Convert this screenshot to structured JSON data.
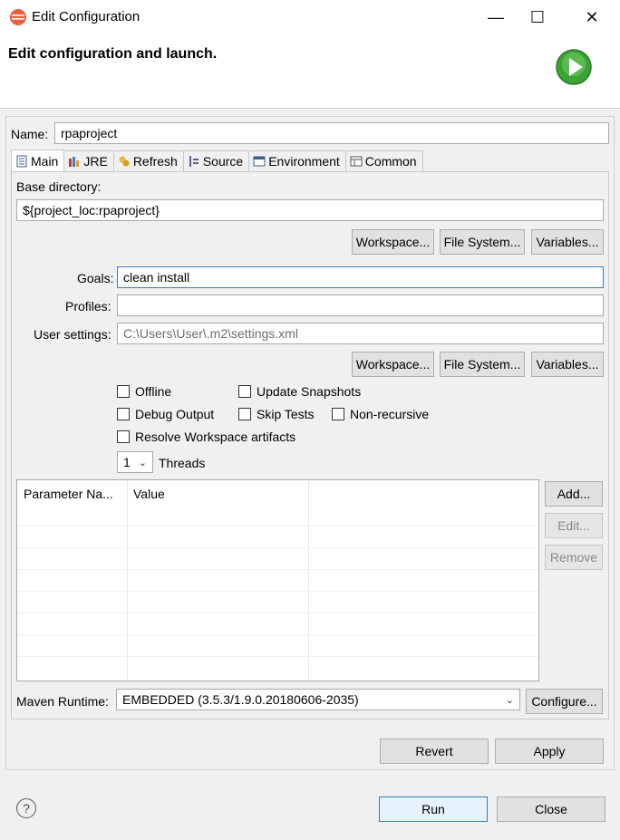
{
  "window": {
    "title": "Edit Configuration",
    "minimize_glyph": "—",
    "maximize_glyph": "☐",
    "close_glyph": "✕"
  },
  "header": {
    "title": "Edit configuration and launch."
  },
  "name": {
    "label": "Name:",
    "value": "rpaproject"
  },
  "tabs": [
    {
      "label": "Main",
      "icon": "main-tab-icon",
      "active": true
    },
    {
      "label": "JRE",
      "icon": "jre-icon"
    },
    {
      "label": "Refresh",
      "icon": "refresh-icon"
    },
    {
      "label": "Source",
      "icon": "source-icon"
    },
    {
      "label": "Environment",
      "icon": "environment-icon"
    },
    {
      "label": "Common",
      "icon": "common-icon"
    }
  ],
  "main": {
    "base_dir_label": "Base directory:",
    "base_dir_value": "${project_loc:rpaproject}",
    "workspace_btn": "Workspace...",
    "filesystem_btn": "File System...",
    "variables_btn": "Variables...",
    "goals_label": "Goals:",
    "goals_value": "clean install",
    "profiles_label": "Profiles:",
    "profiles_value": "",
    "user_settings_label": "User settings:",
    "user_settings_value": "C:\\Users\\User\\.m2\\settings.xml",
    "checkboxes": {
      "offline": "Offline",
      "update_snapshots": "Update Snapshots",
      "debug_output": "Debug Output",
      "skip_tests": "Skip Tests",
      "non_recursive": "Non-recursive",
      "resolve_workspace": "Resolve Workspace artifacts"
    },
    "threads_value": "1",
    "threads_label": "Threads",
    "table": {
      "columns": [
        "Parameter Na...",
        "Value"
      ],
      "rows": []
    },
    "add_btn": "Add...",
    "edit_btn": "Edit...",
    "remove_btn": "Remove",
    "runtime_label": "Maven Runtime:",
    "runtime_value": "EMBEDDED (3.5.3/1.9.0.20180606-2035)",
    "configure_btn": "Configure..."
  },
  "footer": {
    "revert_btn": "Revert",
    "apply_btn": "Apply",
    "run_btn": "Run",
    "close_btn": "Close",
    "help_glyph": "?"
  },
  "colors": {
    "accent": "#3c7fb1",
    "run_green": "#3aa335"
  }
}
